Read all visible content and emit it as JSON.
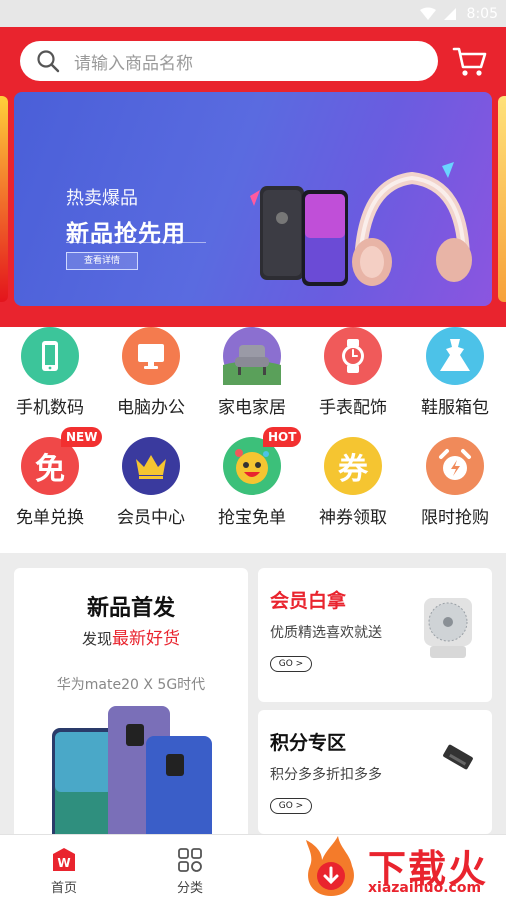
{
  "status_bar": {
    "time": "8:05",
    "icons": [
      "wifi-icon",
      "signal-icon"
    ]
  },
  "search": {
    "placeholder": "请输入商品名称"
  },
  "banner": {
    "subtitle": "热卖爆品",
    "title": "新品抢先用",
    "button": "查看详情"
  },
  "menu": {
    "items": [
      {
        "label": "手机数码",
        "icon": "phone-icon",
        "color": "#3cc59a"
      },
      {
        "label": "电脑办公",
        "icon": "monitor-icon",
        "color": "#f47b4e"
      },
      {
        "label": "家电家居",
        "icon": "sofa-icon",
        "color": "#8b6fd0"
      },
      {
        "label": "手表配饰",
        "icon": "watch-icon",
        "color": "#f05a5a"
      },
      {
        "label": "鞋服箱包",
        "icon": "dress-icon",
        "color": "#4cc2e8"
      },
      {
        "label": "免单兑换",
        "icon": "free-icon",
        "color": "#f04848",
        "tag": "NEW"
      },
      {
        "label": "会员中心",
        "icon": "crown-icon",
        "color": "#3a3a9e"
      },
      {
        "label": "抢宝免单",
        "icon": "mascot-icon",
        "color": "#3cc07a",
        "tag": "HOT"
      },
      {
        "label": "神券领取",
        "icon": "coupon-icon",
        "color": "#f5c531"
      },
      {
        "label": "限时抢购",
        "icon": "alarm-icon",
        "color": "#f08a5a"
      }
    ],
    "coupon_char": "券",
    "free_char": "免"
  },
  "promo_left": {
    "title": "新品首发",
    "sub_prefix": "发现",
    "sub_highlight": "最新好货",
    "model": "华为mate20 X    5G时代"
  },
  "promo_vip": {
    "title": "会员白拿",
    "sub": "优质精选喜欢就送",
    "go": "GO >"
  },
  "promo_points": {
    "title": "积分专区",
    "sub": "积分多多折扣多多",
    "go": "GO >"
  },
  "tabbar": {
    "tabs": [
      {
        "label": "首页",
        "icon": "home-icon",
        "active": true
      },
      {
        "label": "分类",
        "icon": "grid-icon",
        "active": false
      }
    ]
  },
  "watermark": {
    "cn": "下载火",
    "en": "xiazaihuo.com"
  },
  "colors": {
    "brand_red": "#e9242e"
  }
}
